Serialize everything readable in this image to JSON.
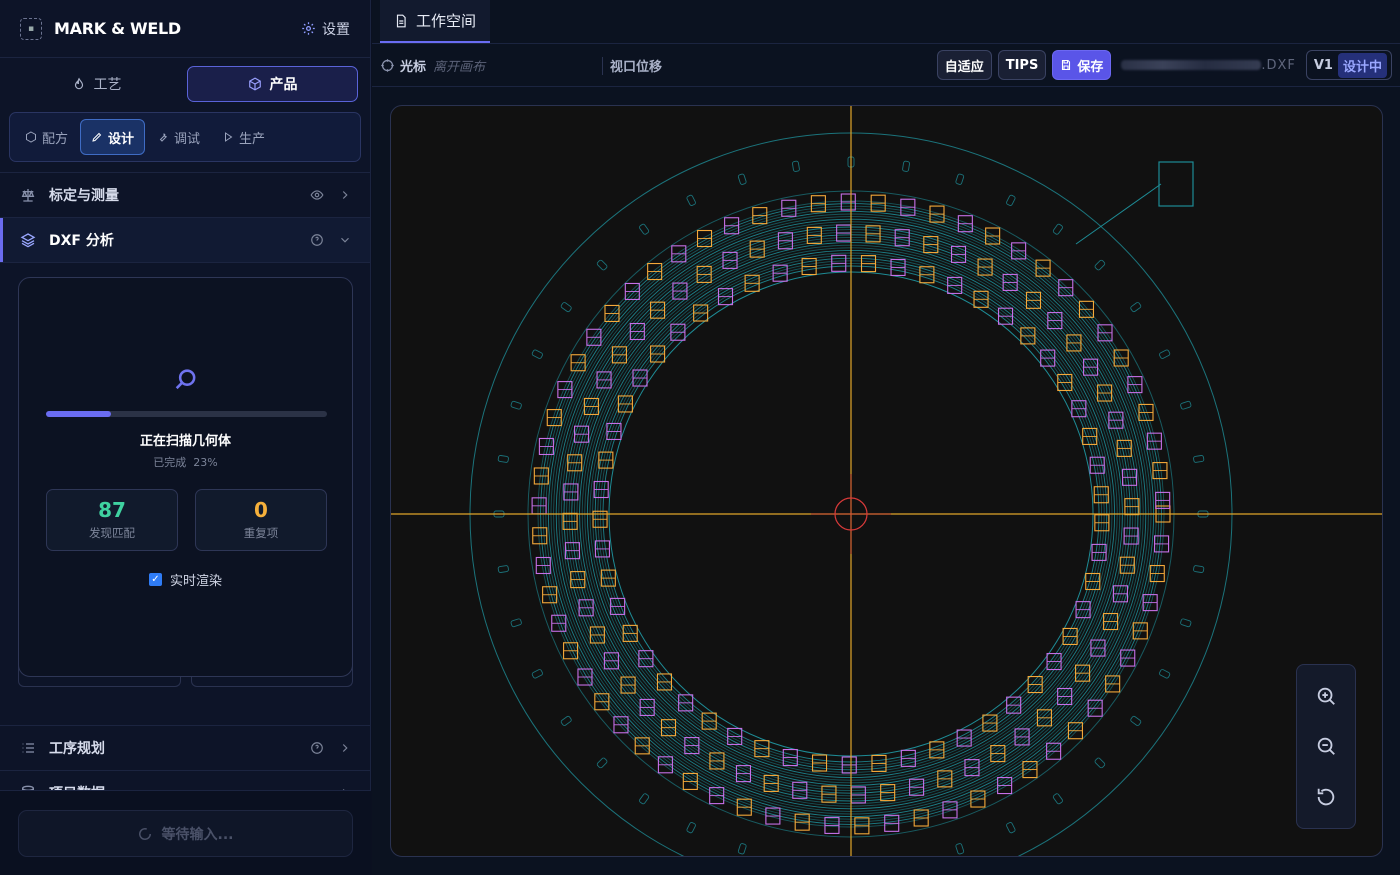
{
  "brand": {
    "name": "MARK & WELD",
    "settings_label": "设置"
  },
  "tabs": [
    {
      "label": "工艺",
      "icon": "flame-icon"
    },
    {
      "label": "产品",
      "icon": "box-icon",
      "active": true
    }
  ],
  "subtabs": [
    {
      "label": "配方",
      "icon": "box-icon"
    },
    {
      "label": "设计",
      "icon": "pencil-icon",
      "active": true
    },
    {
      "label": "调试",
      "icon": "wrench-icon"
    },
    {
      "label": "生产",
      "icon": "play-icon"
    }
  ],
  "sections": {
    "calibration": "标定与测量",
    "dxf": "DXF 分析",
    "process": "工序规划",
    "project": "项目数据"
  },
  "scan": {
    "title": "正在扫描几何体",
    "sub_label": "已完成",
    "progress_text": "23%",
    "progress": 0.23,
    "matches": "87",
    "matches_label": "发现匹配",
    "duplicates": "0",
    "duplicates_label": "重复项",
    "realtime_label": "实时渲染",
    "realtime_checked": true
  },
  "wait_label": "等待输入...",
  "workspace": {
    "tab_label": "工作空间"
  },
  "toolbar": {
    "cursor_label": "光标",
    "cursor_placeholder": "离开画布",
    "viewport_label": "视口位移",
    "fit_label": "自适应",
    "tips_label": "TIPS",
    "save_label": "保存",
    "file_ext": ".DXF",
    "version": "V1",
    "version_state": "设计中"
  },
  "colors": {
    "accent": "#6a6cf2",
    "teal": "#1e8c96",
    "orange": "#f5a93a",
    "purple": "#c770e8",
    "crosshair": "#e0a52a",
    "origin": "#d93a3a"
  }
}
